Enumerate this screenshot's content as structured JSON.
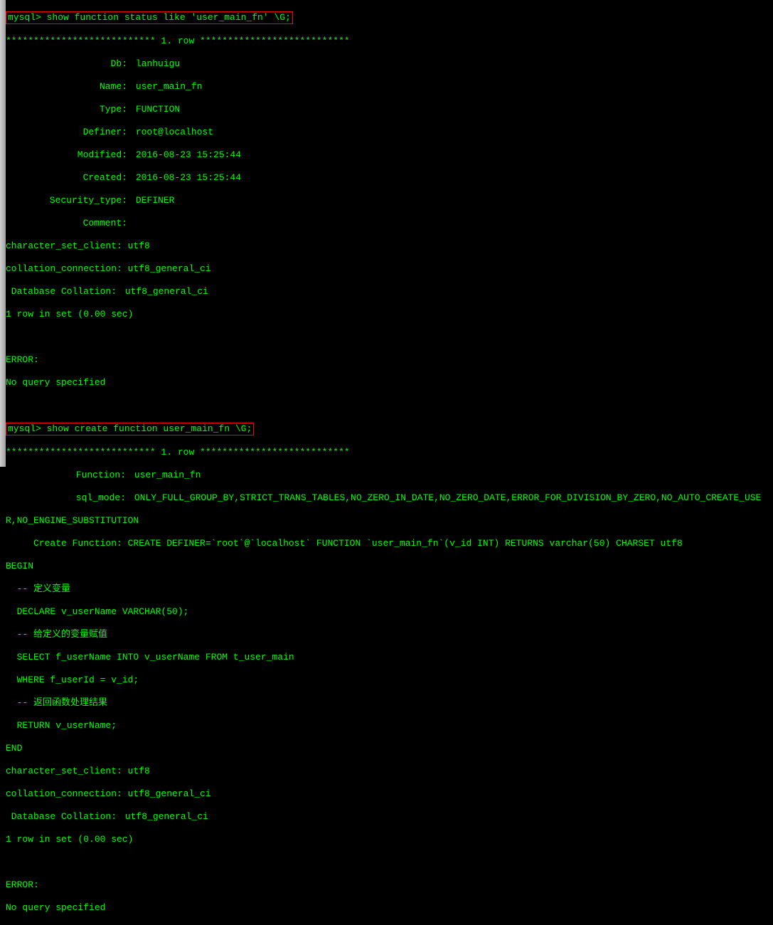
{
  "prompt1": "mysql> show function status like 'user_main_fn' \\G;",
  "row_sep1": "*************************** 1. row ***************************",
  "status": {
    "db_key": "Db:",
    "db_val": "lanhuigu",
    "name_key": "Name:",
    "name_val": "user_main_fn",
    "type_key": "Type:",
    "type_val": "FUNCTION",
    "definer_key": "Definer:",
    "definer_val": "root@localhost",
    "modified_key": "Modified:",
    "modified_val": "2016-08-23 15:25:44",
    "created_key": "Created:",
    "created_val": "2016-08-23 15:25:44",
    "security_key": "Security_type:",
    "security_val": "DEFINER",
    "comment_key": "Comment:",
    "comment_val": "",
    "charset_line": "character_set_client: utf8",
    "collation_line": "collation_connection: utf8_general_ci",
    "dbcoll_key": "Database Collation:",
    "dbcoll_val": "utf8_general_ci"
  },
  "rows_msg1": "1 row in set (0.00 sec)",
  "error_label": "ERROR:",
  "no_query": "No query specified",
  "prompt2": "mysql> show create function user_main_fn \\G;",
  "row_sep2": "*************************** 1. row ***************************",
  "create": {
    "func_key": "Function:",
    "func_val": "user_main_fn",
    "sqlmode_key": "sql_mode:",
    "sqlmode_val": "ONLY_FULL_GROUP_BY,STRICT_TRANS_TABLES,NO_ZERO_IN_DATE,NO_ZERO_DATE,ERROR_FOR_DIVISION_BY_ZERO,NO_AUTO_CREATE_USE",
    "sqlmode_cont": "R,NO_ENGINE_SUBSTITUTION",
    "createfn_key": "Create Function:",
    "createfn_line": "     Create Function: CREATE DEFINER=`root`@`localhost` FUNCTION `user_main_fn`(v_id INT) RETURNS varchar(50) CHARSET utf8",
    "begin": "BEGIN",
    "comment1": "  -- 定义变量",
    "declare": "  DECLARE v_userName VARCHAR(50);",
    "comment2": "  -- 给定义的变量赋值",
    "select": "  SELECT f_userName INTO v_userName FROM t_user_main",
    "where": "  WHERE f_userId = v_id;",
    "comment3": "  -- 返回函数处理结果",
    "return": "  RETURN v_userName;",
    "end": "END",
    "charset": "character_set_client: utf8",
    "collation": "collation_connection: utf8_general_ci",
    "dbcoll_key": "Database Collation:",
    "dbcoll_val": "utf8_general_ci"
  },
  "rows_msg2": "1 row in set (0.00 sec)"
}
